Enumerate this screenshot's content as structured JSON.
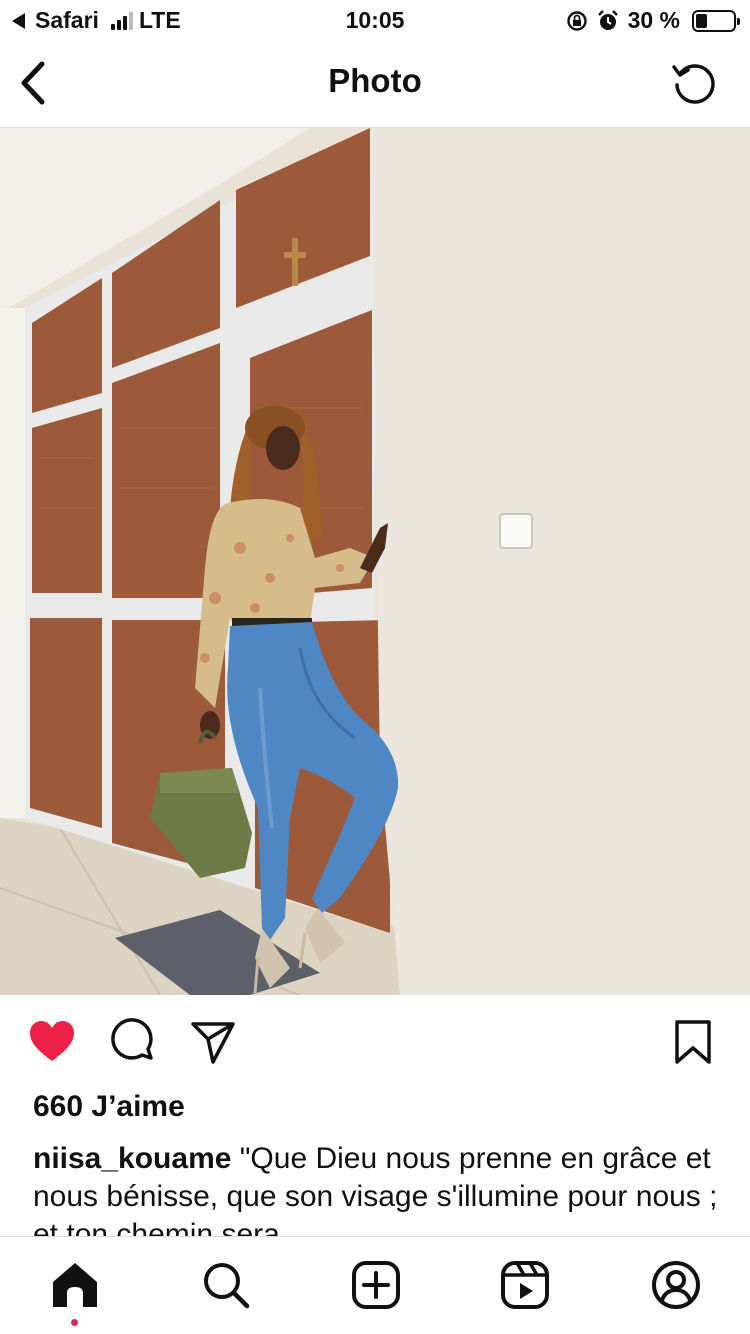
{
  "status_bar": {
    "back_app": "Safari",
    "network": "LTE",
    "time": "10:05",
    "battery_text": "30 %",
    "battery_level": 0.3,
    "icons": [
      "back-triangle-icon",
      "signal-icon",
      "rotation-lock-icon",
      "alarm-icon",
      "battery-icon"
    ]
  },
  "header": {
    "title": "Photo",
    "back_icon": "chevron-left-icon",
    "refresh_icon": "refresh-icon"
  },
  "photo": {
    "subject": "photo-of-woman-in-jeans",
    "accent": "#b0683f"
  },
  "actions": {
    "like_color": "#ed2148",
    "icons": [
      "heart-filled-icon",
      "comment-icon",
      "share-icon",
      "bookmark-icon"
    ]
  },
  "post": {
    "likes": "660 J’aime",
    "username": "niisa_kouame",
    "caption": "\"Que Dieu nous prenne en grâce et nous bénisse, que son visage s'illumine pour nous ; et ton chemin sera"
  },
  "tabbar": {
    "icons": [
      "home-icon",
      "search-icon",
      "new-post-icon",
      "reels-icon",
      "profile-icon"
    ],
    "active_dot_color": "#e0245e"
  }
}
